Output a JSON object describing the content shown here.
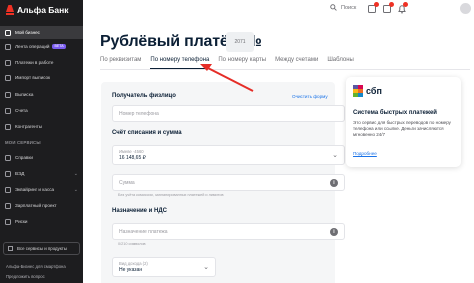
{
  "sidebar": {
    "logo_text": "Альфа Банк",
    "items": [
      {
        "label": "Мой бизнес",
        "icon": "home-icon",
        "active": true
      },
      {
        "label": "Лента операций",
        "icon": "list-icon",
        "badge": "BETA"
      },
      {
        "label": "Платежи в работе",
        "icon": "payments-icon"
      },
      {
        "label": "Импорт выписок",
        "icon": "import-icon"
      },
      {
        "label": "Выписка",
        "icon": "statement-icon"
      },
      {
        "label": "Счета",
        "icon": "accounts-icon"
      },
      {
        "label": "Контрагенты",
        "icon": "contacts-icon"
      }
    ],
    "section_title": "МОИ СЕРВИСЫ",
    "services": [
      {
        "label": "Справки",
        "icon": "doc-icon"
      },
      {
        "label": "ВЭД",
        "icon": "globe-icon",
        "chevron": true
      },
      {
        "label": "Эквайринг и касса",
        "icon": "card-icon",
        "chevron": true
      },
      {
        "label": "Зарплатный проект",
        "icon": "salary-icon"
      },
      {
        "label": "Риски",
        "icon": "risk-icon"
      }
    ],
    "all_services_label": "Все сервисы и продукты",
    "footer_lines": [
      "Альфа-Бизнес для смартфона",
      "Предложить вопрос"
    ]
  },
  "topbar": {
    "search_label": "Поиск",
    "search_icon": "search-icon",
    "icons": [
      "calendar-icon",
      "mail-icon",
      "bell-icon"
    ]
  },
  "page": {
    "title": "Рублёвый платёж №",
    "doc_number": "2071",
    "tabs": [
      {
        "label": "По реквизитам",
        "active": false
      },
      {
        "label": "По номеру телефона",
        "active": true
      },
      {
        "label": "По номеру карты",
        "active": false
      },
      {
        "label": "Между счетами",
        "active": false
      },
      {
        "label": "Шаблоны",
        "active": false
      }
    ]
  },
  "form": {
    "recipient_heading": "Получатель физлицо",
    "clear_link": "Очистить форму",
    "phone_placeholder": "Номер телефона",
    "account_heading": "Счёт списания и сумма",
    "account_caption": "Имеве ·4560",
    "account_balance": "16 148,65 ₽",
    "amount_placeholder": "Сумма",
    "amount_hint": "Без учёта комиссии, запланированных платежей и лимитов",
    "purpose_heading": "Назначение и НДС",
    "purpose_placeholder": "Назначение платежа",
    "purpose_hint": "0/210 символов",
    "tax_caption": "Вид дохода (2)",
    "tax_value": "Не указан"
  },
  "sbp_card": {
    "logo_text": "сбп",
    "heading": "Система быстрых платежей",
    "description": "Это сервис для быстрых переводов по номеру телефона или ссылке. Деньги зачисляются мгновенно 24/7",
    "more_link": "Подробнее",
    "logo_colors": [
      "#5b57a2",
      "#d90751",
      "#fab718",
      "#ed6f26",
      "#63b22f",
      "#1487c9"
    ]
  },
  "accent_color": "#ef3124"
}
